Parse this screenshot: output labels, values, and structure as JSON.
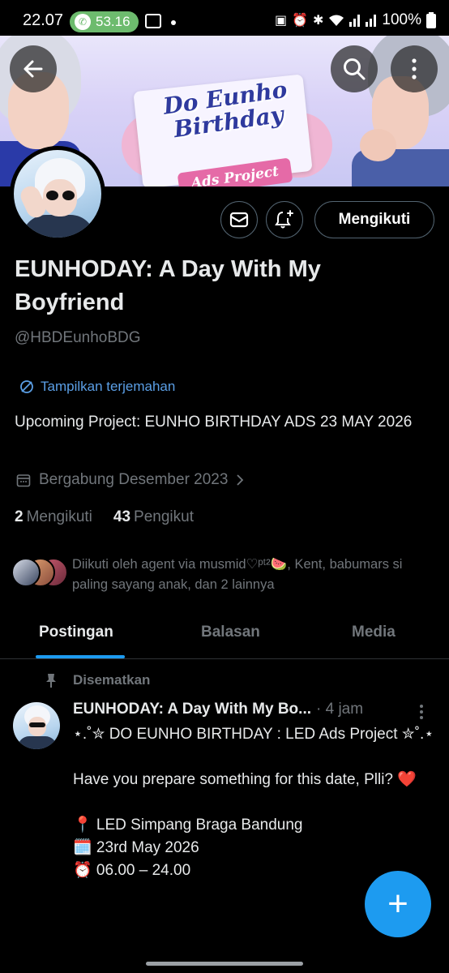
{
  "status_bar": {
    "time": "22.07",
    "call_timer": "53.16",
    "battery": "100%",
    "icons": [
      "phone-icon",
      "gallery-icon",
      "dot-icon",
      "nfc-icon",
      "alarm-icon",
      "bluetooth-icon",
      "wifi-icon",
      "signal-icon",
      "signal-icon",
      "battery-icon"
    ]
  },
  "banner": {
    "title_line1": "Do Eunho",
    "title_line2": "Birthday",
    "subtitle": "Ads Project"
  },
  "header_buttons": {
    "back_icon": "arrow-left-icon",
    "search_icon": "search-icon",
    "more_icon": "more-vertical-icon"
  },
  "actions": {
    "follow_label": "Mengikuti",
    "mail_icon": "envelope-icon",
    "notify_icon": "bell-plus-icon"
  },
  "profile": {
    "name": "EUNHODAY: A Day With My Boyfriend",
    "handle": "@HBDEunhoBDG",
    "translate_label": "Tampilkan terjemahan",
    "bio": "Upcoming Project: EUNHO BIRTHDAY ADS 23 MAY 2026",
    "joined": "Bergabung Desember 2023",
    "following_count": "2",
    "following_label": "Mengikuti",
    "followers_count": "43",
    "followers_label": "Pengikut",
    "followed_by": "Diikuti oleh agent via musmid♡ᵖᵗ²🍉, Kent, babumars si paling sayang anak, dan 2 lainnya"
  },
  "tabs": [
    {
      "label": "Postingan",
      "active": true
    },
    {
      "label": "Balasan",
      "active": false
    },
    {
      "label": "Media",
      "active": false
    }
  ],
  "post": {
    "pinned_label": "Disematkan",
    "author": "EUNHODAY: A Day With My Bo...",
    "time": "· 4 jam",
    "body": "⋆.˚✮ DO EUNHO BIRTHDAY : LED Ads Project ✮˚.⋆\n\nHave you prepare something for this date, Plli? ❤️\n\n📍 LED Simpang Braga Bandung\n🗓️ 23rd May 2026\n⏰ 06.00 – 24.00"
  },
  "fab_label": "+",
  "colors": {
    "accent": "#1d9bf0",
    "link": "#5b9fe6",
    "muted": "#71767b",
    "call_pill": "#6dbb6e"
  }
}
